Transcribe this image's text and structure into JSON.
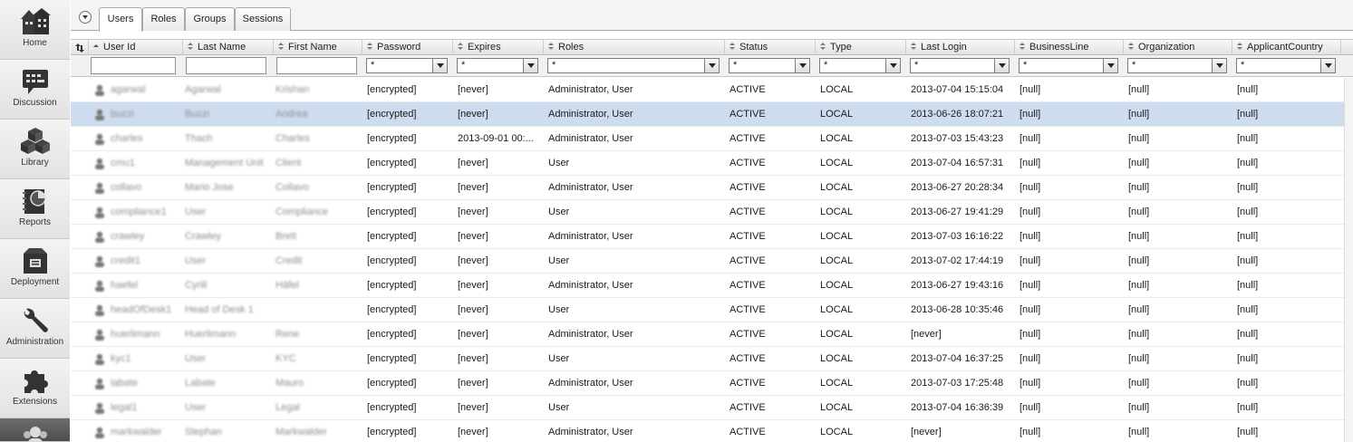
{
  "sidebar": {
    "items": [
      {
        "label": "Home",
        "icon": "home-icon"
      },
      {
        "label": "Discussion",
        "icon": "discussion-icon"
      },
      {
        "label": "Library",
        "icon": "library-icon"
      },
      {
        "label": "Reports",
        "icon": "reports-icon"
      },
      {
        "label": "Deployment",
        "icon": "deployment-icon"
      },
      {
        "label": "Administration",
        "icon": "wrench-icon"
      },
      {
        "label": "Extensions",
        "icon": "puzzle-icon"
      },
      {
        "label": "",
        "icon": "users-icon"
      }
    ]
  },
  "tabs": [
    "Users",
    "Roles",
    "Groups",
    "Sessions"
  ],
  "columns": [
    "User Id",
    "Last Name",
    "First Name",
    "Password",
    "Expires",
    "Roles",
    "Status",
    "Type",
    "Last Login",
    "BusinessLine",
    "Organization",
    "ApplicantCountry"
  ],
  "filters": {
    "text": [
      "",
      "",
      ""
    ],
    "select_value": "*"
  },
  "rows": [
    [
      "agarwal",
      "Agarwal",
      "Krishan",
      "[encrypted]",
      "[never]",
      "Administrator, User",
      "ACTIVE",
      "LOCAL",
      "2013-07-04 15:15:04",
      "[null]",
      "[null]",
      "[null]"
    ],
    [
      "buzzi",
      "Buzzi",
      "Andrea",
      "[encrypted]",
      "[never]",
      "Administrator, User",
      "ACTIVE",
      "LOCAL",
      "2013-06-26 18:07:21",
      "[null]",
      "[null]",
      "[null]"
    ],
    [
      "charles",
      "Thach",
      "Charles",
      "[encrypted]",
      "2013-09-01 00:...",
      "Administrator, User",
      "ACTIVE",
      "LOCAL",
      "2013-07-03 15:43:23",
      "[null]",
      "[null]",
      "[null]"
    ],
    [
      "cmu1",
      "Management Unit",
      "Client",
      "[encrypted]",
      "[never]",
      "User",
      "ACTIVE",
      "LOCAL",
      "2013-07-04 16:57:31",
      "[null]",
      "[null]",
      "[null]"
    ],
    [
      "collavo",
      "Mario Jose",
      "Collavo",
      "[encrypted]",
      "[never]",
      "Administrator, User",
      "ACTIVE",
      "LOCAL",
      "2013-06-27 20:28:34",
      "[null]",
      "[null]",
      "[null]"
    ],
    [
      "compliance1",
      "User",
      "Compliance",
      "[encrypted]",
      "[never]",
      "User",
      "ACTIVE",
      "LOCAL",
      "2013-06-27 19:41:29",
      "[null]",
      "[null]",
      "[null]"
    ],
    [
      "crawley",
      "Crawley",
      "Brett",
      "[encrypted]",
      "[never]",
      "Administrator, User",
      "ACTIVE",
      "LOCAL",
      "2013-07-03 16:16:22",
      "[null]",
      "[null]",
      "[null]"
    ],
    [
      "credit1",
      "User",
      "Credit",
      "[encrypted]",
      "[never]",
      "User",
      "ACTIVE",
      "LOCAL",
      "2013-07-02 17:44:19",
      "[null]",
      "[null]",
      "[null]"
    ],
    [
      "haefel",
      "Cyrill",
      "Häfel",
      "[encrypted]",
      "[never]",
      "Administrator, User",
      "ACTIVE",
      "LOCAL",
      "2013-06-27 19:43:16",
      "[null]",
      "[null]",
      "[null]"
    ],
    [
      "headOfDesk1",
      "Head of Desk 1",
      "",
      "[encrypted]",
      "[never]",
      "User",
      "ACTIVE",
      "LOCAL",
      "2013-06-28 10:35:46",
      "[null]",
      "[null]",
      "[null]"
    ],
    [
      "huerlimann",
      "Huerlimann",
      "Rene",
      "[encrypted]",
      "[never]",
      "Administrator, User",
      "ACTIVE",
      "LOCAL",
      "[never]",
      "[null]",
      "[null]",
      "[null]"
    ],
    [
      "kyc1",
      "User",
      "KYC",
      "[encrypted]",
      "[never]",
      "User",
      "ACTIVE",
      "LOCAL",
      "2013-07-04 16:37:25",
      "[null]",
      "[null]",
      "[null]"
    ],
    [
      "labate",
      "Labate",
      "Mauro",
      "[encrypted]",
      "[never]",
      "Administrator, User",
      "ACTIVE",
      "LOCAL",
      "2013-07-03 17:25:48",
      "[null]",
      "[null]",
      "[null]"
    ],
    [
      "legal1",
      "User",
      "Legal",
      "[encrypted]",
      "[never]",
      "User",
      "ACTIVE",
      "LOCAL",
      "2013-07-04 16:36:39",
      "[null]",
      "[null]",
      "[null]"
    ],
    [
      "markwalder",
      "Stephan",
      "Markwalder",
      "[encrypted]",
      "[never]",
      "Administrator, User",
      "ACTIVE",
      "LOCAL",
      "[never]",
      "[null]",
      "[null]",
      "[null]"
    ]
  ]
}
